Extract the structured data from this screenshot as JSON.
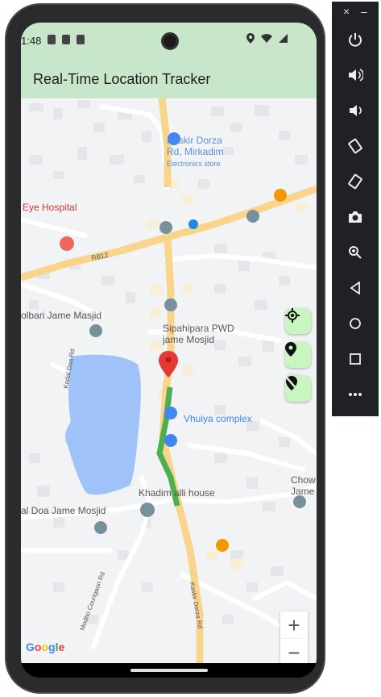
{
  "status": {
    "time": "1:48"
  },
  "appbar": {
    "title": "Real-Time Location Tracker"
  },
  "map": {
    "road_label": "R812",
    "pois": [
      {
        "name": "Kaskir Dorza Rd, Mirkadim",
        "sub": "Electronics store"
      },
      {
        "name": "Eye Hospital"
      },
      {
        "name": "olbari Jame Masjid"
      },
      {
        "name": "Sipahipara PWD jame Mosjid"
      },
      {
        "name": "Vhuiya complex"
      },
      {
        "name": "Khadim alli house"
      },
      {
        "name": "al Doa Jame Mosjid"
      },
      {
        "name": "Chow Jame"
      },
      {
        "name": "Kodal Doa Rd"
      },
      {
        "name": "Modho Courtgaon Rd"
      },
      {
        "name": "Kaskir Dorza Rd"
      }
    ],
    "google_logo": "Google",
    "zoom_in": "+",
    "zoom_out": "−",
    "route_color": "#4caf50",
    "marker_color": "#e53935"
  },
  "fabs": [
    {
      "icon": "my-location-icon"
    },
    {
      "icon": "location-pin-icon"
    },
    {
      "icon": "location-off-icon"
    }
  ],
  "emulator": {
    "close": "×",
    "minimize": "–",
    "buttons": [
      "power-icon",
      "volume-up-icon",
      "volume-down-icon",
      "rotate-left-icon",
      "rotate-right-icon",
      "camera-icon",
      "zoom-icon",
      "back-icon",
      "home-icon",
      "overview-icon",
      "more-icon"
    ]
  }
}
